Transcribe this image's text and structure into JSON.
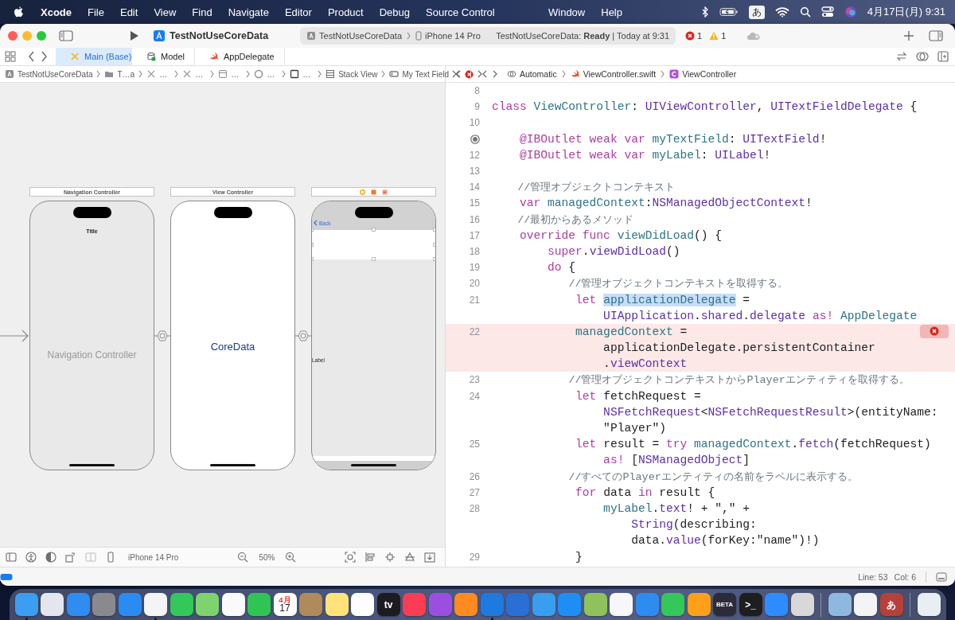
{
  "menubar": {
    "app": "Xcode",
    "menus": [
      "File",
      "Edit",
      "View",
      "Find",
      "Navigate",
      "Editor",
      "Product",
      "Debug",
      "Source Control"
    ],
    "menus_right_of_notch": [
      "Window",
      "Help"
    ],
    "input_method": "あ",
    "clock": "4月17日(月)  9:31"
  },
  "toolbar": {
    "project": "TestNotUseCoreData",
    "scheme": "TestNotUseCoreData",
    "destination": "iPhone 14 Pro",
    "status": "TestNotUseCoreData: **Ready** | Today at 9:31",
    "errors": "1",
    "warnings": "1"
  },
  "tabs": [
    {
      "label": "Main (Base)",
      "kind": "storyboard",
      "selected": true
    },
    {
      "label": "Model",
      "kind": "datamodel",
      "selected": false
    },
    {
      "label": "AppDelegate",
      "kind": "swift",
      "selected": false
    }
  ],
  "storyboard_path": [
    {
      "label": "TestNotUseCoreData",
      "kind": "project"
    },
    {
      "label": "T…a",
      "kind": "folder"
    },
    {
      "label": "…",
      "kind": "storyboard"
    },
    {
      "label": "…",
      "kind": "storyboard"
    },
    {
      "label": "…",
      "kind": "scene"
    },
    {
      "label": "…",
      "kind": "controller"
    },
    {
      "label": "…",
      "kind": "view"
    },
    {
      "label": "Stack View",
      "kind": "stack"
    },
    {
      "label": "My Text Field",
      "kind": "textfield"
    }
  ],
  "editor_path": [
    {
      "label": "Automatic",
      "kind": "related"
    },
    {
      "label": "ViewController.swift",
      "kind": "swift"
    },
    {
      "label": "ViewController",
      "kind": "class"
    }
  ],
  "scenes": [
    {
      "title": "Navigation Controller",
      "kind": "navigation",
      "header": "Title",
      "label": "Navigation Controller"
    },
    {
      "title": "View Controller",
      "kind": "plain",
      "label": "CoreData"
    },
    {
      "kind": "detail",
      "back": "Back",
      "label": "Label"
    }
  ],
  "canvas_bar": {
    "device": "iPhone 14 Pro",
    "zoom": "50%"
  },
  "code": [
    {
      "number": "8",
      "outlet": false,
      "error": false
    },
    {
      "number": "9",
      "outlet": false,
      "error": false,
      "rows": [
        {
          "tokens": [
            {
              "kind": "keyword",
              "text": "class "
            },
            {
              "kind": "project",
              "text": "ViewController"
            },
            {
              "kind": "plain",
              "text": ": "
            },
            {
              "kind": "system",
              "text": "UIViewController"
            },
            {
              "kind": "plain",
              "text": ", "
            },
            {
              "kind": "system",
              "text": "UITextFieldDelegate"
            },
            {
              "kind": "plain",
              "text": " {"
            }
          ]
        }
      ]
    },
    {
      "number": "10",
      "outlet": false,
      "error": false
    },
    {
      "outlet": true,
      "error": false,
      "rows": [
        {
          "tokens": [
            {
              "kind": "keyword",
              "text": "    @IBOutlet weak var "
            },
            {
              "kind": "project",
              "text": "myTextField"
            },
            {
              "kind": "plain",
              "text": ": "
            },
            {
              "kind": "system",
              "text": "UITextField"
            },
            {
              "kind": "plain",
              "text": "!"
            }
          ]
        }
      ]
    },
    {
      "number": "12",
      "outlet": false,
      "error": false,
      "rows": [
        {
          "tokens": [
            {
              "kind": "keyword",
              "text": "    @IBOutlet weak var "
            },
            {
              "kind": "project",
              "text": "myLabel"
            },
            {
              "kind": "plain",
              "text": ": "
            },
            {
              "kind": "system",
              "text": "UILabel"
            },
            {
              "kind": "plain",
              "text": "!"
            }
          ]
        }
      ]
    },
    {
      "number": "13",
      "outlet": false,
      "error": false
    },
    {
      "number": "14",
      "outlet": false,
      "error": false,
      "rows": [
        {
          "tokens": [
            {
              "kind": "comment",
              "text": "    //管理オブジェクトコンテキスト"
            }
          ]
        }
      ]
    },
    {
      "number": "15",
      "outlet": false,
      "error": false,
      "rows": [
        {
          "tokens": [
            {
              "kind": "keyword",
              "text": "    var "
            },
            {
              "kind": "project",
              "text": "managedContext"
            },
            {
              "kind": "plain",
              "text": ":"
            },
            {
              "kind": "system",
              "text": "NSManagedObjectContext"
            },
            {
              "kind": "plain",
              "text": "!"
            }
          ]
        }
      ]
    },
    {
      "number": "16",
      "outlet": false,
      "error": false,
      "rows": [
        {
          "tokens": [
            {
              "kind": "comment",
              "text": "    //最初からあるメソッド"
            }
          ]
        }
      ]
    },
    {
      "number": "17",
      "outlet": false,
      "error": false,
      "rows": [
        {
          "tokens": [
            {
              "kind": "keyword",
              "text": "    override func "
            },
            {
              "kind": "project",
              "text": "viewDidLoad"
            },
            {
              "kind": "plain",
              "text": "() {"
            }
          ]
        }
      ]
    },
    {
      "number": "18",
      "outlet": false,
      "error": false,
      "rows": [
        {
          "tokens": [
            {
              "kind": "keyword",
              "text": "        super"
            },
            {
              "kind": "plain",
              "text": "."
            },
            {
              "kind": "system",
              "text": "viewDidLoad"
            },
            {
              "kind": "plain",
              "text": "()"
            }
          ]
        }
      ]
    },
    {
      "number": "19",
      "outlet": false,
      "error": false,
      "rows": [
        {
          "tokens": [
            {
              "kind": "keyword",
              "text": "        do"
            },
            {
              "kind": "plain",
              "text": " {"
            }
          ]
        }
      ]
    },
    {
      "number": "20",
      "outlet": false,
      "error": false,
      "rows": [
        {
          "tokens": [
            {
              "kind": "comment",
              "text": "            //管理オブジェクトコンテキストを取得する。"
            }
          ]
        }
      ]
    },
    {
      "number": "21",
      "outlet": false,
      "error": false,
      "rows": [
        {
          "tokens": [
            {
              "kind": "keyword",
              "text": "            let "
            },
            {
              "kind": "selected",
              "text": "applicationDelegate"
            },
            {
              "kind": "plain",
              "text": " ="
            }
          ]
        },
        {
          "tokens": [
            {
              "kind": "system",
              "text": "                UIApplication"
            },
            {
              "kind": "plain",
              "text": "."
            },
            {
              "kind": "system",
              "text": "shared"
            },
            {
              "kind": "plain",
              "text": "."
            },
            {
              "kind": "system",
              "text": "delegate"
            },
            {
              "kind": "keyword",
              "text": " as! "
            },
            {
              "kind": "project",
              "text": "AppDelegate"
            }
          ]
        }
      ]
    },
    {
      "number": "22",
      "outlet": false,
      "error": true,
      "rows": [
        {
          "tokens": [
            {
              "kind": "project",
              "text": "            managedContext"
            },
            {
              "kind": "plain",
              "text": " ="
            }
          ]
        },
        {
          "tokens": [
            {
              "kind": "plain",
              "text": "                applicationDelegate.persistentContainer"
            }
          ]
        },
        {
          "tokens": [
            {
              "kind": "plain",
              "text": "                ."
            },
            {
              "kind": "system",
              "text": "viewContext"
            }
          ]
        }
      ]
    },
    {
      "number": "23",
      "outlet": false,
      "error": false,
      "rows": [
        {
          "tokens": [
            {
              "kind": "comment",
              "text": "            //管理オブジェクトコンテキストからPlayerエンティティを取得する。"
            }
          ]
        }
      ]
    },
    {
      "number": "24",
      "outlet": false,
      "error": false,
      "rows": [
        {
          "tokens": [
            {
              "kind": "keyword",
              "text": "            let"
            },
            {
              "kind": "plain",
              "text": " fetchRequest ="
            }
          ]
        },
        {
          "tokens": [
            {
              "kind": "system",
              "text": "                NSFetchRequest"
            },
            {
              "kind": "plain",
              "text": "<"
            },
            {
              "kind": "system",
              "text": "NSFetchRequestResult"
            },
            {
              "kind": "plain",
              "text": ">(entityName:"
            }
          ]
        },
        {
          "tokens": [
            {
              "kind": "plain",
              "text": "                \"Player\")"
            }
          ]
        }
      ]
    },
    {
      "number": "25",
      "outlet": false,
      "error": false,
      "rows": [
        {
          "tokens": [
            {
              "kind": "keyword",
              "text": "            let"
            },
            {
              "kind": "plain",
              "text": " result = "
            },
            {
              "kind": "keyword",
              "text": "try "
            },
            {
              "kind": "project",
              "text": "managedContext"
            },
            {
              "kind": "plain",
              "text": "."
            },
            {
              "kind": "system",
              "text": "fetch"
            },
            {
              "kind": "plain",
              "text": "(fetchRequest)"
            }
          ]
        },
        {
          "tokens": [
            {
              "kind": "keyword",
              "text": "                as!"
            },
            {
              "kind": "plain",
              "text": " ["
            },
            {
              "kind": "system",
              "text": "NSManagedObject"
            },
            {
              "kind": "plain",
              "text": "]"
            }
          ]
        }
      ]
    },
    {
      "number": "26",
      "outlet": false,
      "error": false,
      "rows": [
        {
          "tokens": [
            {
              "kind": "comment",
              "text": "            //すべてのPlayerエンティティの名前をラベルに表示する。"
            }
          ]
        }
      ]
    },
    {
      "number": "27",
      "outlet": false,
      "error": false,
      "rows": [
        {
          "tokens": [
            {
              "kind": "keyword",
              "text": "            for"
            },
            {
              "kind": "plain",
              "text": " data "
            },
            {
              "kind": "keyword",
              "text": "in"
            },
            {
              "kind": "plain",
              "text": " result {"
            }
          ]
        }
      ]
    },
    {
      "number": "28",
      "outlet": false,
      "error": false,
      "rows": [
        {
          "tokens": [
            {
              "kind": "project",
              "text": "                myLabel"
            },
            {
              "kind": "plain",
              "text": "."
            },
            {
              "kind": "system",
              "text": "text"
            },
            {
              "kind": "plain",
              "text": "! + \",\" +"
            }
          ]
        },
        {
          "tokens": [
            {
              "kind": "system",
              "text": "                    String"
            },
            {
              "kind": "plain",
              "text": "(describing:"
            }
          ]
        },
        {
          "tokens": [
            {
              "kind": "plain",
              "text": "                    data."
            },
            {
              "kind": "system",
              "text": "value"
            },
            {
              "kind": "plain",
              "text": "(forKey:\"name\")!)"
            }
          ]
        }
      ]
    },
    {
      "number": "29",
      "outlet": false,
      "error": false,
      "rows": [
        {
          "tokens": [
            {
              "kind": "plain",
              "text": "            }"
            }
          ]
        }
      ]
    }
  ],
  "cursor": {
    "line": "Line: 53",
    "column": "Col: 6"
  },
  "dock": [
    [
      {
        "color": "#3b9ef2",
        "running": true
      },
      {
        "color": "#e4e6ee",
        "running": false
      },
      {
        "color": "#2f8cf0",
        "running": false
      },
      {
        "color": "#8a8a8e",
        "running": false
      },
      {
        "color": "#2a8cf2",
        "running": false
      },
      {
        "color": "#f4f4f4",
        "running": true
      },
      {
        "color": "#34c759",
        "running": false
      },
      {
        "color": "#7ed36f",
        "running": false
      },
      {
        "color": "#fafafa",
        "running": false
      },
      {
        "color": "#30c552",
        "running": false
      },
      {
        "color": "#ffffff",
        "running": false,
        "texts": [
          "4月",
          "17"
        ]
      },
      {
        "color": "#b08a5a",
        "running": false
      },
      {
        "color": "#ffe27a",
        "running": false
      },
      {
        "color": "#fdfdfd",
        "running": false
      },
      {
        "color": "#1c1c1e",
        "running": false,
        "texts": [
          "tv"
        ]
      },
      {
        "color": "#fa3c55",
        "running": false
      },
      {
        "color": "#9b4fe0",
        "running": false
      },
      {
        "color": "#ff8a1f",
        "running": false
      },
      {
        "color": "#1f7ae0",
        "running": true
      },
      {
        "color": "#2a6fd6",
        "running": false
      },
      {
        "color": "#3a9ef0",
        "running": false
      },
      {
        "color": "#1e8ef5",
        "running": false
      },
      {
        "color": "#8fc25a",
        "running": false
      },
      {
        "color": "#f7f7f7",
        "running": false
      },
      {
        "color": "#2d8cf0",
        "running": false
      },
      {
        "color": "#34c759",
        "running": false
      },
      {
        "color": "#ff9f1a",
        "running": false
      },
      {
        "color": "#2b2b3a",
        "running": false,
        "texts": [
          "BETA"
        ]
      },
      {
        "color": "#1e1e1e",
        "running": false,
        "texts": [
          ">_"
        ]
      },
      {
        "color": "#2d8cff",
        "running": false
      },
      {
        "color": "#d8d8d8",
        "running": false
      }
    ],
    [
      {
        "color": "#8fb8e0",
        "running": false
      },
      {
        "color": "#f4f4f4",
        "running": false
      },
      {
        "color": "#b5413a",
        "running": false,
        "texts": [
          "あ"
        ]
      }
    ],
    [
      {
        "color": "#e8eef2",
        "running": false
      }
    ]
  ]
}
